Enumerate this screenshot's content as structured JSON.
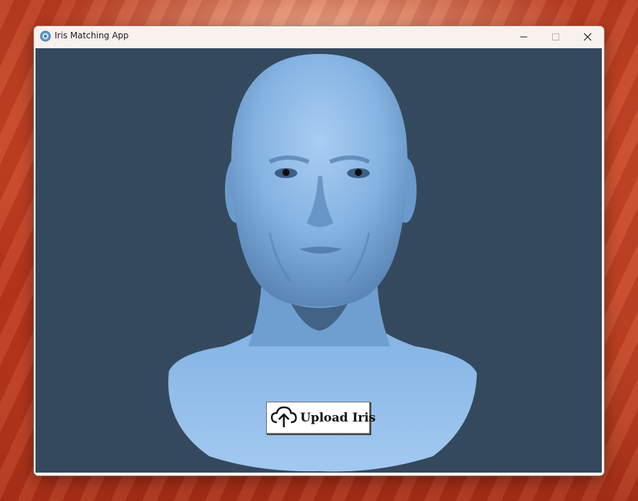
{
  "window": {
    "title": "Iris Matching App",
    "icon": "gear-globe-icon",
    "controls": [
      "minimize-icon",
      "maximize-icon",
      "close-icon"
    ]
  },
  "main": {
    "background_color": "#34495e",
    "image": "3d-head-bust",
    "upload_button": {
      "icon": "cloud-upload-icon",
      "label": "Upload Iris"
    }
  },
  "desktop": {
    "wallpaper": "red-sandstone-canyon"
  }
}
